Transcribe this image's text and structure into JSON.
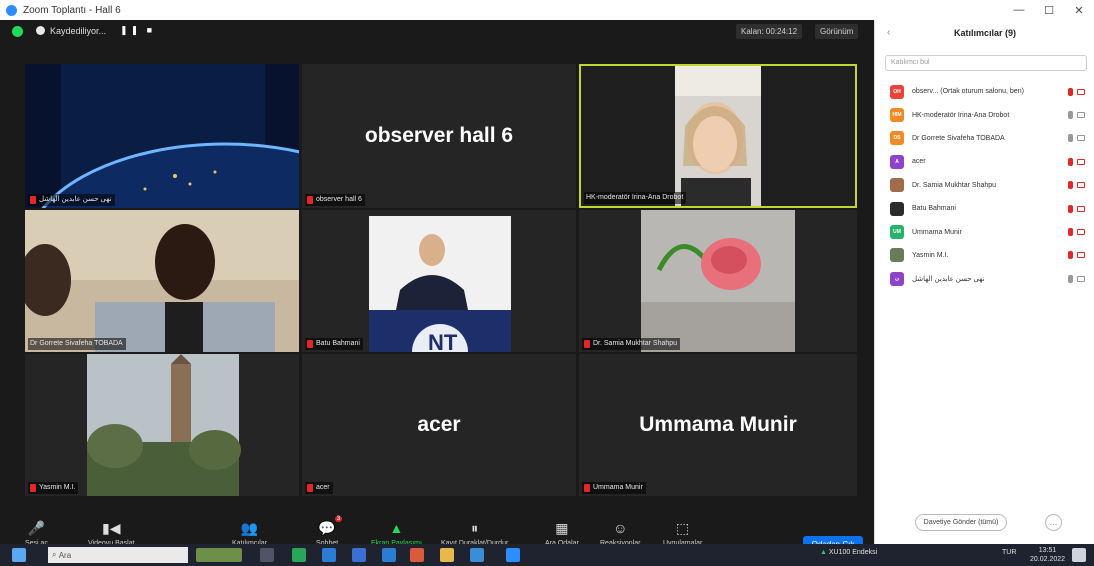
{
  "window": {
    "title": "Zoom Toplantı - Hall 6",
    "controls": [
      "—",
      "☐",
      "✕"
    ]
  },
  "topbar": {
    "recording_label": "Kaydediliyor...",
    "timer": "Kalan: 00:24:12",
    "view_label": "Görünüm"
  },
  "tiles": [
    {
      "name": "نهى حسن عابدين الهاشل",
      "type": "earth"
    },
    {
      "name": "observer hall 6",
      "big": "observer hall 6"
    },
    {
      "name": "HK-moderatör Irina-Ana Drobot",
      "type": "woman",
      "active": true
    },
    {
      "name": "Dr Gorrete Sivafeha TOBADA",
      "type": "man"
    },
    {
      "name": "Batu Bahmani",
      "type": "podium"
    },
    {
      "name": "Dr. Samia Mukhtar Shahpu",
      "type": "rose"
    },
    {
      "name": "Yasmin M.I.",
      "type": "tower"
    },
    {
      "name": "acer",
      "big": "acer"
    },
    {
      "name": "Ummama Munir",
      "big": "Ummama Munir"
    }
  ],
  "toolbar": {
    "items": [
      {
        "label": "Sesi aç",
        "icon": "microphone-icon",
        "glyph": "🎤"
      },
      {
        "label": "Videoyu Başlat",
        "icon": "video-camera-icon",
        "glyph": "▮◀"
      },
      {
        "label": "Katılımcılar",
        "icon": "participants-icon",
        "glyph": "👥"
      },
      {
        "label": "Sohbet",
        "icon": "chat-icon",
        "glyph": "💬"
      },
      {
        "label": "Ekran Paylaşımı",
        "icon": "share-screen-icon",
        "glyph": "▲"
      },
      {
        "label": "Kayıt Duraklat/Durdur",
        "icon": "recording-controls-icon",
        "glyph": "⏸"
      },
      {
        "label": "Ara Odalar",
        "icon": "breakout-rooms-icon",
        "glyph": "▦"
      },
      {
        "label": "Reaksiyonlar",
        "icon": "reactions-icon",
        "glyph": "☺"
      },
      {
        "label": "Uygulamalar",
        "icon": "apps-icon",
        "glyph": "⬚"
      }
    ],
    "chat_badge": "3",
    "leave_label": "Odadan Çık"
  },
  "participants": {
    "title": "Katılımcılar (9)",
    "search_placeholder": "Katılımcı bul",
    "list": [
      {
        "initials": "OH",
        "color": "#e8443a",
        "name": "observ... (Ortak oturum salonu, ben)"
      },
      {
        "initials": "HIM",
        "color": "#f08a24",
        "name": "HK-moderatör Irina-Ana Drobot"
      },
      {
        "initials": "DS",
        "color": "#f08a24",
        "name": "Dr Gorrete Sivafeha TOBADA"
      },
      {
        "initials": "A",
        "color": "#8e44c9",
        "name": "acer"
      },
      {
        "initials": "",
        "color": "#a06b4a",
        "name": "Dr. Samia Mukhtar Shahpu"
      },
      {
        "initials": "",
        "color": "#2c2c2c",
        "name": "Batu Bahmani"
      },
      {
        "initials": "UM",
        "color": "#27b36b",
        "name": "Ummama Munir"
      },
      {
        "initials": "",
        "color": "#6a7b59",
        "name": "Yasmin M.I."
      },
      {
        "initials": "ن",
        "color": "#8e44c9",
        "name": "نهى حسن عابدين الهاشل"
      }
    ],
    "invite_label": "Davetiye Gönder (tümü)",
    "more_label": "…"
  },
  "taskbar": {
    "search_text": "Ara",
    "tray_text": "XU100 Endeksi",
    "lang": "TUR",
    "time": "13:51",
    "date": "20.02.2022"
  }
}
